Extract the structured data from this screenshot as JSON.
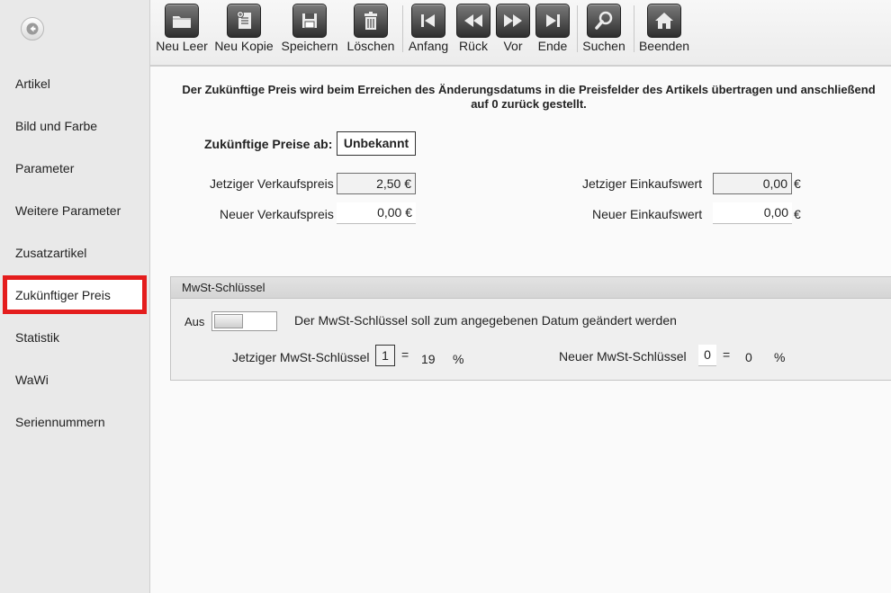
{
  "toolbar": {
    "buttons": [
      {
        "label": "Neu Leer",
        "icon": "folder-icon"
      },
      {
        "label": "Neu Kopie",
        "icon": "copy-icon"
      },
      {
        "label": "Speichern",
        "icon": "save-icon"
      },
      {
        "label": "Löschen",
        "icon": "trash-icon"
      },
      {
        "label": "Anfang",
        "icon": "first-icon"
      },
      {
        "label": "Rück",
        "icon": "rewind-icon"
      },
      {
        "label": "Vor",
        "icon": "forward-icon"
      },
      {
        "label": "Ende",
        "icon": "last-icon"
      },
      {
        "label": "Suchen",
        "icon": "search-icon"
      },
      {
        "label": "Beenden",
        "icon": "home-icon"
      }
    ]
  },
  "sidebar": {
    "items": [
      {
        "label": "Artikel"
      },
      {
        "label": "Bild und Farbe"
      },
      {
        "label": "Parameter"
      },
      {
        "label": "Weitere Parameter"
      },
      {
        "label": "Zusatzartikel"
      },
      {
        "label": "Zukünftiger Preis",
        "active": true
      },
      {
        "label": "Statistik"
      },
      {
        "label": "WaWi"
      },
      {
        "label": "Seriennummern"
      }
    ]
  },
  "main": {
    "notice_line1": "Der Zukünftige Preis wird beim Erreichen des Änderungsdatums in die Preisfelder des Artikels übertragen und anschließend",
    "notice_line2": "auf 0 zurück gestellt.",
    "future_from_label": "Zukünftige Preise ab:",
    "future_from_value": "Unbekannt",
    "current_sale_label": "Jetziger Verkaufspreis",
    "current_sale_value": "2,50 €",
    "new_sale_label": "Neuer Verkaufspreis",
    "new_sale_value": "0,00 €",
    "current_purchase_label": "Jetziger Einkaufswert",
    "current_purchase_value": "0,00",
    "new_purchase_label": "Neuer Einkaufswert",
    "new_purchase_value": "0,00",
    "currency": "€"
  },
  "mwst": {
    "title": "MwSt-Schlüssel",
    "toggle_label": "Aus",
    "toggle_on": false,
    "description": "Der MwSt-Schlüssel soll zum angegebenen Datum geändert werden",
    "current_label": "Jetziger MwSt-Schlüssel",
    "current_key": "1",
    "current_rate": "19",
    "new_label": "Neuer MwSt-Schlüssel",
    "new_key": "0",
    "new_rate": "0",
    "equals": "=",
    "percent": "%"
  },
  "colors": {
    "active_nav_border": "#e41d1d",
    "sidebar_bg": "#e9e9e9",
    "toolbar_icon_bg": "#3a3a3a"
  }
}
